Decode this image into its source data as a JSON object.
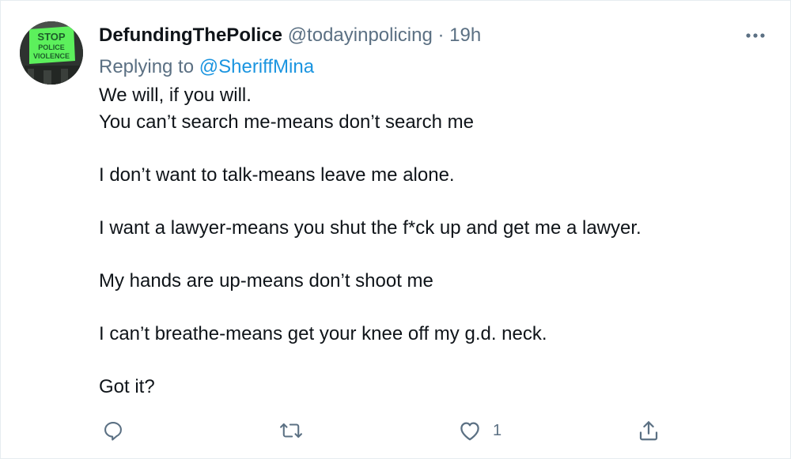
{
  "tweet": {
    "display_name": "DefundingThePolice",
    "handle": "@todayinpolicing",
    "separator": "·",
    "time": "19h",
    "replying_prefix": "Replying to",
    "replying_to": "@SheriffMina",
    "avatar_sign": {
      "line1": "STOP",
      "line2": "POLICE",
      "line3": "VIOLENCE"
    },
    "lines": [
      "We will, if you will.",
      "You can’t search me-means don’t search me",
      "",
      "I don’t want to talk-means leave me alone.",
      "",
      "I want a lawyer-means you shut the f*ck up and get me a lawyer.",
      "",
      "My hands are up-means don’t shoot me",
      "",
      "I can’t breathe-means get your knee off my g.d. neck.",
      "",
      "Got it?"
    ]
  },
  "actions": {
    "reply_icon": "reply-icon",
    "retweet_icon": "retweet-icon",
    "like_icon": "heart-icon",
    "like_count": "1",
    "share_icon": "share-icon"
  },
  "colors": {
    "text": "#0f1419",
    "secondary": "#5b7083",
    "link": "#1b95e0",
    "border": "#e6ecf0",
    "sign_green": "#5cf05c"
  }
}
